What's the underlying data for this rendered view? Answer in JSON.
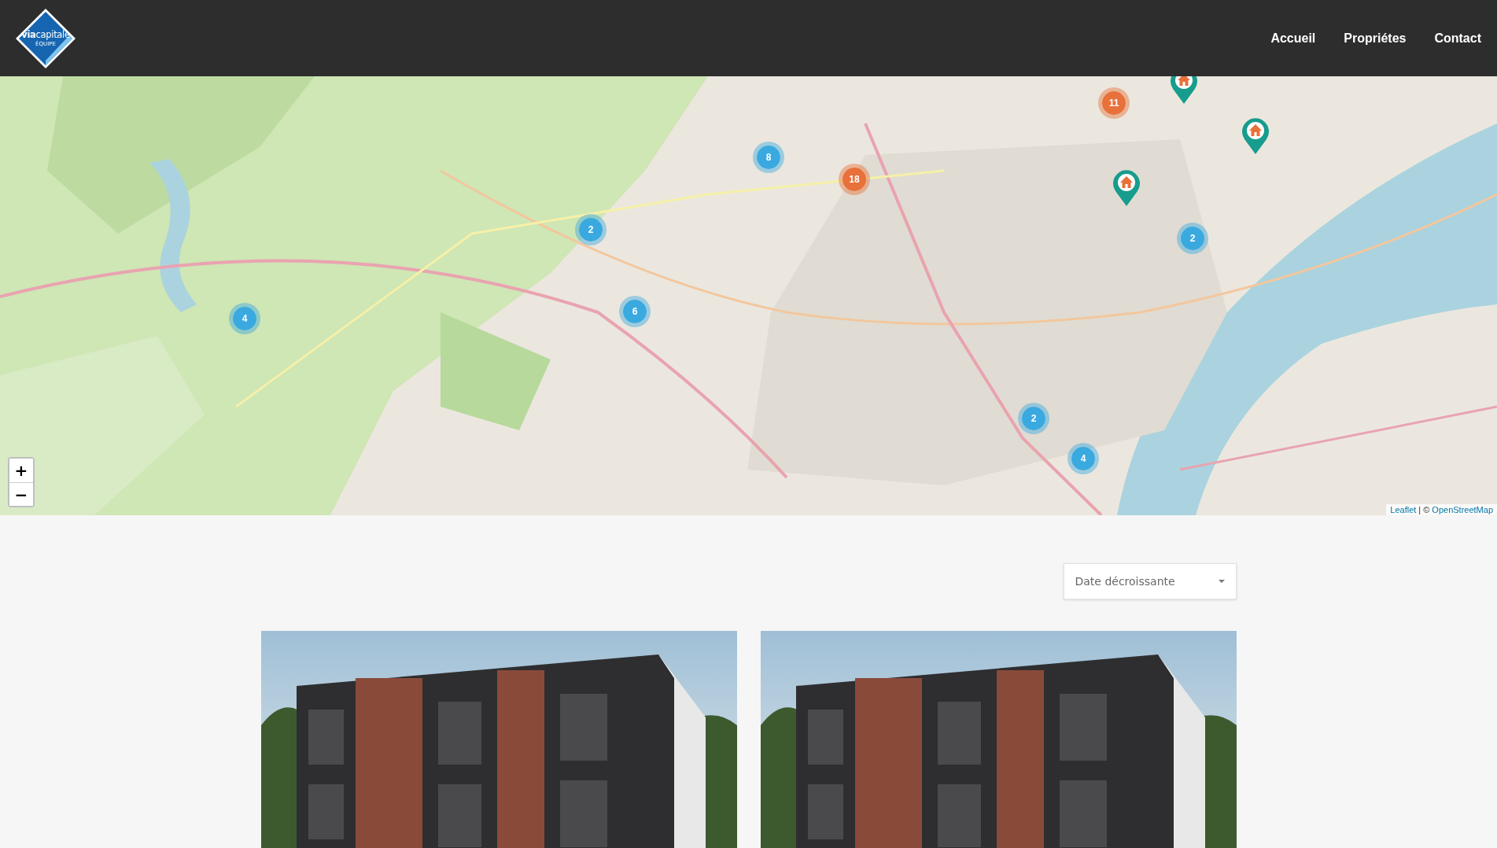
{
  "header": {
    "logo": {
      "name": "**via**capitale",
      "subtitle": "ÉQUIPE"
    },
    "nav": [
      {
        "label": "Accueil"
      },
      {
        "label": "Propriétes"
      },
      {
        "label": "Contact"
      }
    ]
  },
  "map": {
    "clusters": [
      {
        "count": "11",
        "color": "#e8703a"
      },
      {
        "count": "8",
        "color": "#3aa9e0"
      },
      {
        "count": "18",
        "color": "#e8703a"
      },
      {
        "count": "2",
        "color": "#3aa9e0"
      },
      {
        "count": "2",
        "color": "#3aa9e0"
      },
      {
        "count": "4",
        "color": "#3aa9e0"
      },
      {
        "count": "6",
        "color": "#3aa9e0"
      },
      {
        "count": "2",
        "color": "#3aa9e0"
      },
      {
        "count": "4",
        "color": "#3aa9e0"
      }
    ],
    "pins": [
      {
        "kind": "home"
      },
      {
        "kind": "home"
      },
      {
        "kind": "home"
      }
    ],
    "zoom_controls": [
      "+",
      "−"
    ],
    "attribution": {
      "links": [
        "Leaflet",
        "OpenStreetMap"
      ],
      "separator": "| ©"
    }
  },
  "sort": {
    "value": "Date décroissante"
  },
  "listings": [
    {
      "kind": "photo"
    },
    {
      "kind": "photo"
    }
  ]
}
